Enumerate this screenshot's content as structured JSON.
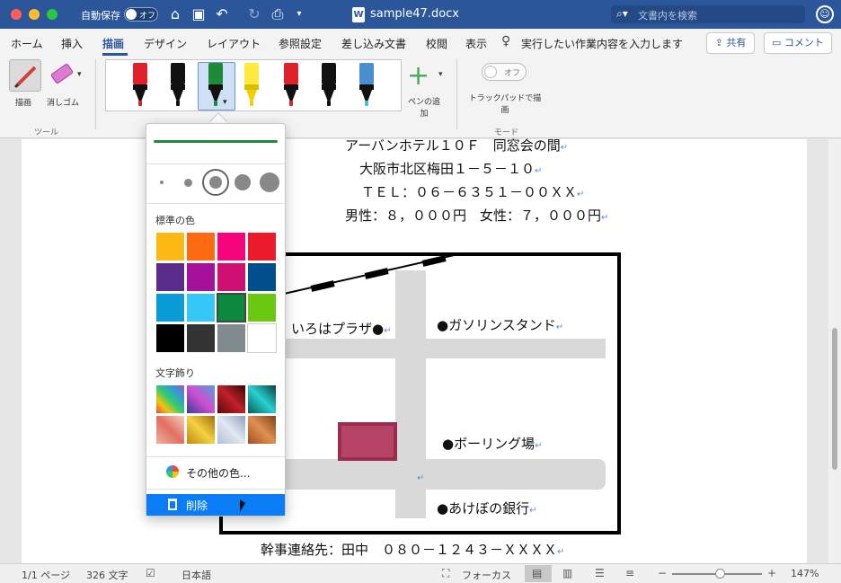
{
  "window": {
    "autosave_label": "自動保存",
    "autosave_state": "オフ",
    "title": "sample47.docx",
    "search_placeholder": "文書内を検索"
  },
  "ribbon_tabs": [
    "ホーム",
    "挿入",
    "描画",
    "デザイン",
    "レイアウト",
    "参照設定",
    "差し込み文書",
    "校閲",
    "表示"
  ],
  "active_tab": "描画",
  "tell_me": "実行したい作業内容を入力します",
  "share_label": "共有",
  "comment_label": "コメント",
  "ribbon": {
    "draw_label": "描画",
    "erase_label": "消しゴム",
    "tools_group": "ツール",
    "add_pen_label": "ペンの追加",
    "trackpad_state": "オフ",
    "trackpad_label": "トラックパッドで描画",
    "mode_group": "モード",
    "pens": [
      {
        "color": "#e0202a",
        "tip": "#e0202a"
      },
      {
        "color": "#111111",
        "tip": "#111111"
      },
      {
        "color": "#1e8a3a",
        "tip": "#1e8a3a"
      },
      {
        "color": "#ffe940",
        "tip": "#f0d000"
      },
      {
        "color": "#e0202a",
        "tip": "#e0202a"
      },
      {
        "color": "#111111",
        "tip": "#111111"
      },
      {
        "color": "#4a8fd0",
        "tip": "#4ac0d0"
      }
    ]
  },
  "document": {
    "lines": [
      "アーバンホテル１０Ｆ　同窓会の間",
      "大阪市北区梅田１－５－１０",
      "ＴＥＬ：０６－６３５１－００ＸＸ",
      "男性：８，０００円　女性：７，０００円"
    ],
    "footer_line": "幹事連絡先：田中　０８０－１２４３－ＸＸＸＸ",
    "map_labels": {
      "iroha": "いろはプラザ●",
      "gas": "●ガソリンスタンド",
      "bowling": "●ボーリング場",
      "bank": "●あけぼの銀行"
    }
  },
  "popup": {
    "standard_colors_label": "標準の色",
    "standard_colors": [
      "#fdb913",
      "#fd6a12",
      "#f7047c",
      "#ec1b2c",
      "#5a2c8c",
      "#a6119b",
      "#d01070",
      "#004e8c",
      "#0a9bd9",
      "#35c7f5",
      "#0b8a3e",
      "#6bc70f",
      "#000000",
      "#333333",
      "#818a8f",
      "#ffffff"
    ],
    "selected_color": "#0b8a3e",
    "texture_label": "文字飾り",
    "textures": [
      "linear-gradient(45deg,#e74c3c,#f1c40f,#2ecc71,#3498db,#9b59b6)",
      "linear-gradient(45deg,#3b3b9a,#d04fd0,#4fa0e0)",
      "linear-gradient(45deg,#5a0a0a,#c0202a,#3a0505)",
      "linear-gradient(45deg,#0a5a5a,#2ad0d0,#064040)",
      "linear-gradient(45deg,#f0b0a0,#e07060,#f8d0c0)",
      "linear-gradient(45deg,#c08a10,#f5d040,#a07008)",
      "linear-gradient(45deg,#b0c0d8,#e0e8f0,#90a0c0)",
      "linear-gradient(45deg,#a05020,#e09050,#804018)"
    ],
    "more_colors": "その他の色...",
    "delete_label": "削除"
  },
  "statusbar": {
    "page": "1/1 ページ",
    "words": "326 文字",
    "language": "日本語",
    "focus": "フォーカス",
    "zoom": "147%"
  }
}
